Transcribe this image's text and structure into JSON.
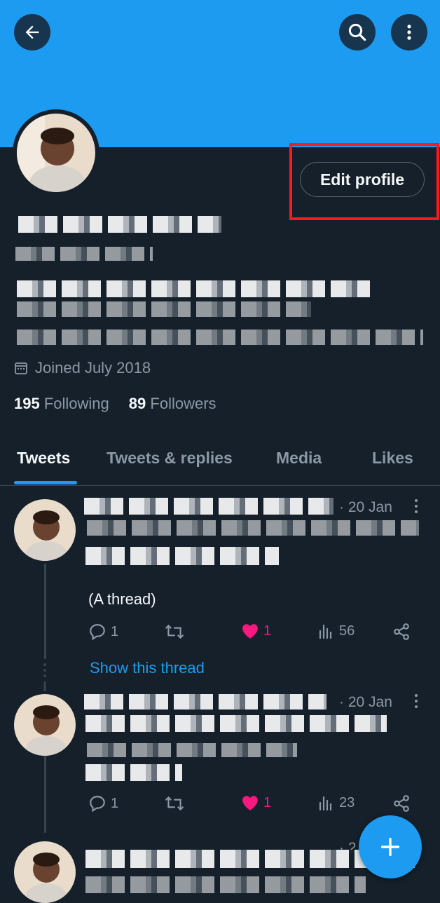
{
  "header": {
    "back_icon": "arrow-left-icon",
    "search_icon": "search-icon",
    "more_icon": "more-vertical-icon"
  },
  "profile": {
    "edit_label": "Edit profile",
    "joined": "Joined July 2018",
    "following_count": "195",
    "following_label": "Following",
    "followers_count": "89",
    "followers_label": "Followers"
  },
  "tabs": [
    {
      "label": "Tweets"
    },
    {
      "label": "Tweets & replies"
    },
    {
      "label": "Media"
    },
    {
      "label": "Likes"
    }
  ],
  "tweets": [
    {
      "date": "· 20 Jan",
      "extra_text": "(A thread)",
      "replies": "1",
      "likes": "1",
      "views": "56"
    },
    {
      "date": "· 20 Jan",
      "replies": "1",
      "likes": "1",
      "views": "23"
    },
    {
      "date": "· 2"
    }
  ],
  "show_thread_label": "Show this thread",
  "colors": {
    "accent": "#1d9bf0",
    "background": "#15202b",
    "like": "#f91880",
    "highlight": "#ff1a1a"
  }
}
